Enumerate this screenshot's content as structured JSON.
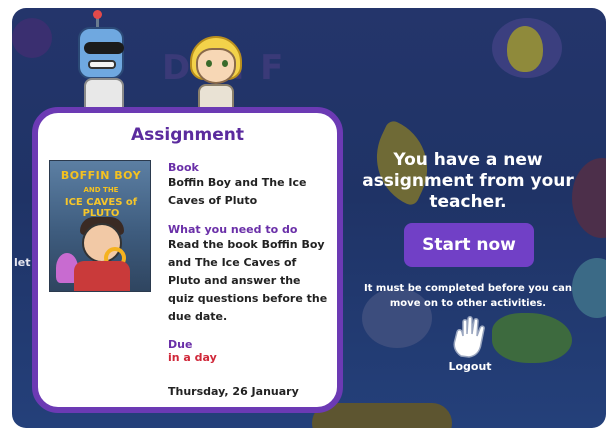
{
  "background": {
    "partial_text": "let"
  },
  "assignment_card": {
    "title": "Assignment",
    "book_label": "Book",
    "book_title": "Boffin Boy and The Ice Caves of Pluto",
    "todo_label": "What you need to do",
    "todo_text": "Read the book Boffin Boy and The Ice Caves of Pluto and answer the quiz questions before the due date.",
    "due_label": "Due",
    "due_relative": "in a day",
    "due_date": "Thursday, 26 January",
    "cover": {
      "series": "BOFFIN BOY",
      "and_the": "AND THE",
      "subtitle": "ICE CAVES of PLUTO"
    }
  },
  "panel": {
    "message": "You have a new assignment from your teacher.",
    "start_button": "Start now",
    "note": "It must be completed before you can move on to other activities.",
    "logout_label": "Logout"
  },
  "colors": {
    "card_border": "#6c3ab4",
    "button": "#7140c6",
    "label": "#6a2fa8",
    "due": "#d0283a"
  },
  "icons": {
    "logout": "waving-hand-icon"
  }
}
